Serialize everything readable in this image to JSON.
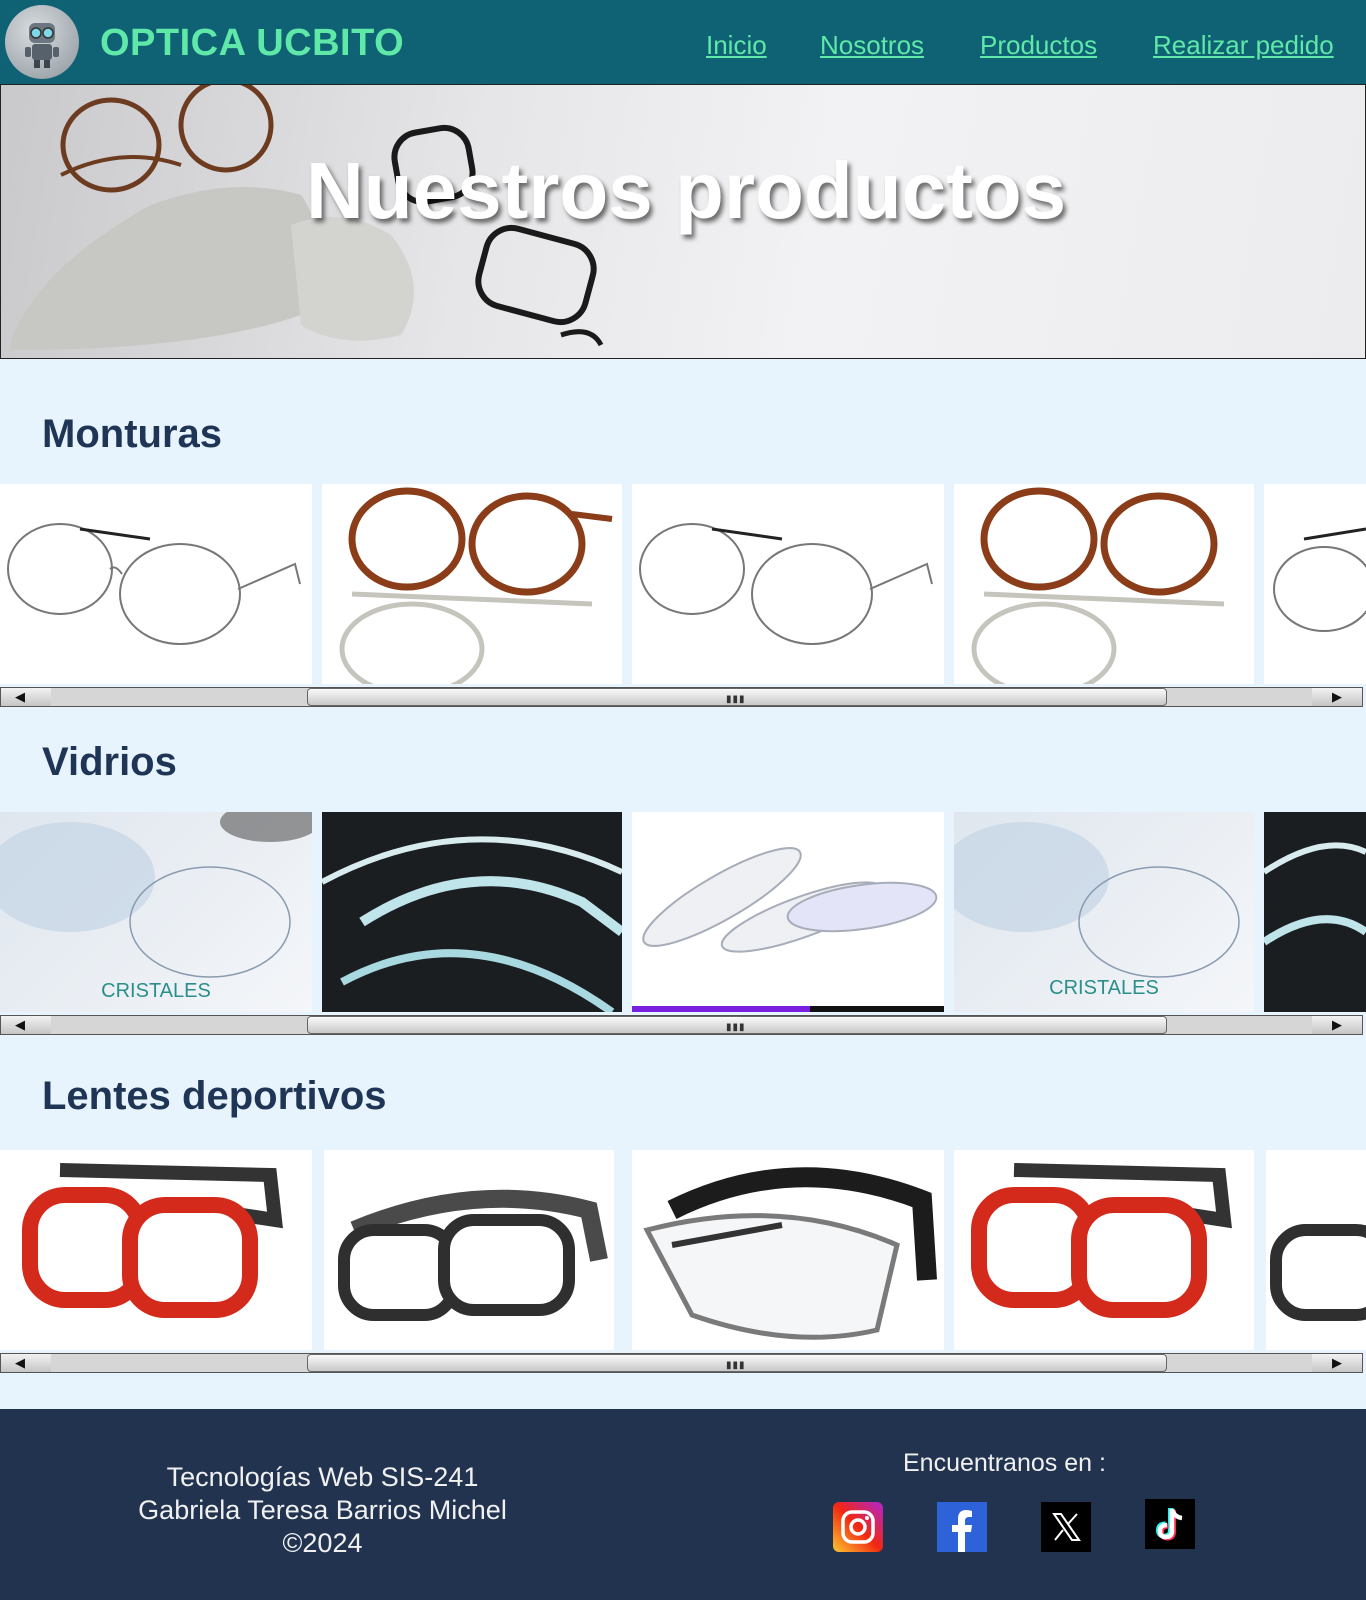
{
  "header": {
    "brand": "OPTICA UCBITO",
    "nav": [
      {
        "label": "Inicio"
      },
      {
        "label": "Nosotros"
      },
      {
        "label": "Productos"
      },
      {
        "label": "Realizar pedido"
      }
    ]
  },
  "hero": {
    "title": "Nuestros productos"
  },
  "sections": [
    {
      "title": "Monturas"
    },
    {
      "title": "Vidrios",
      "card_caption": "CRISTALES"
    },
    {
      "title": "Lentes deportivos"
    }
  ],
  "footer": {
    "course": "Tecnologías Web SIS-241",
    "author": "Gabriela Teresa Barrios Michel",
    "year": "©2024",
    "find_us": "Encuentranos en :",
    "socials": [
      "instagram-icon",
      "facebook-icon",
      "x-icon",
      "tiktok-icon"
    ]
  },
  "colors": {
    "header_bg": "#0f6274",
    "brand_green": "#5fe8a8",
    "page_bg": "#e8f4fd",
    "title_navy": "#1f3555",
    "footer_bg": "#22334f"
  }
}
